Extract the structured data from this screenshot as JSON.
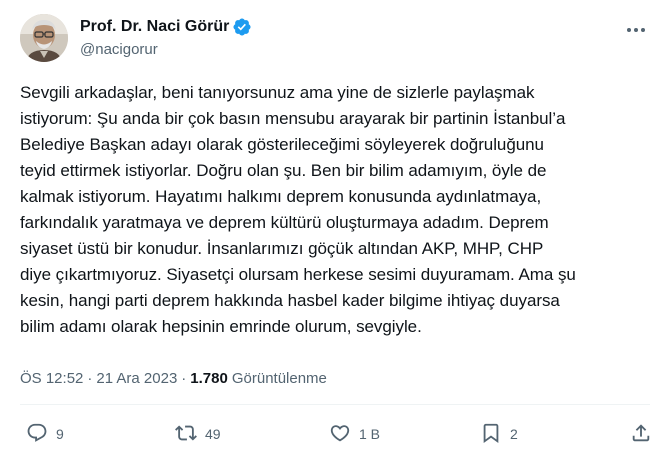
{
  "author": {
    "display_name": "Prof. Dr. Naci Görür",
    "handle": "@nacigorur",
    "verified": true
  },
  "tweet": {
    "text": "Sevgili arkadaşlar, beni tanıyorsunuz ama yine de sizlerle paylaşmak\nistiyorum: Şu anda bir çok basın mensubu arayarak bir partinin İstanbul’a\nBelediye Başkan adayı olarak gösterileceğimi söyleyerek doğruluğunu\nteyid ettirmek istiyorlar. Doğru olan şu. Ben bir bilim adamıyım, öyle de\nkalmak istiyorum. Hayatımı halkımı deprem konusunda aydınlatmaya,\nfarkındalık yaratmaya ve deprem kültürü oluşturmaya adadım. Deprem\nsiyaset üstü bir konudur. İnsanlarımızı göçük altından AKP, MHP, CHP\ndiye çıkartmıyoruz. Siyasetçi olursam herkese sesimi duyuramam. Ama şu\nkesin, hangi parti deprem hakkında hasbel kader bilgime ihtiyaç duyarsa\nbilim adamı olarak hepsinin emrinde olurum, sevgiyle."
  },
  "meta": {
    "time": "ÖS 12:52",
    "separator": "·",
    "date": "21 Ara 2023",
    "views_count": "1.780",
    "views_label": "Görüntülenme"
  },
  "actions": {
    "reply_count": "9",
    "retweet_count": "49",
    "like_count": "1 B",
    "bookmark_count": "2"
  },
  "colors": {
    "verified_blue": "#1d9bf0",
    "secondary_text": "#536471",
    "primary_text": "#0f1419"
  },
  "icons": [
    "verified-badge-icon",
    "more-icon",
    "reply-icon",
    "retweet-icon",
    "like-icon",
    "bookmark-icon",
    "share-icon"
  ]
}
